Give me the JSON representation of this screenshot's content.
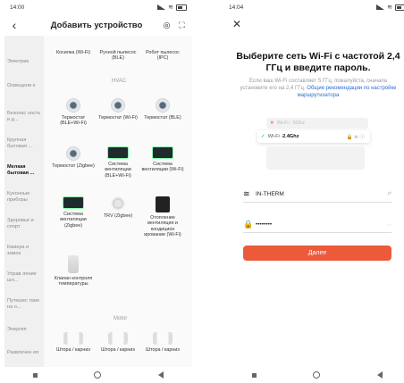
{
  "left": {
    "status_time": "14:00",
    "title": "Добавить устройство",
    "categories": [
      {
        "label": "Электрик",
        "active": false
      },
      {
        "label": "Освещени е",
        "active": false
      },
      {
        "label": "Безопас ность и д...",
        "active": false
      },
      {
        "label": "Крупная бытовая ...",
        "active": false
      },
      {
        "label": "Мелкая бытовая ...",
        "active": true
      },
      {
        "label": "Кухонные приборы",
        "active": false
      },
      {
        "label": "Здоровье и спорт",
        "active": false
      },
      {
        "label": "Камера и замок",
        "active": false
      },
      {
        "label": "Управ ление шл...",
        "active": false
      },
      {
        "label": "Путешес твие на о...",
        "active": false
      },
      {
        "label": "Энергия",
        "active": false
      },
      {
        "label": "Развлечен ия",
        "active": false
      }
    ],
    "section_hvac": "HVAC",
    "section_motor": "Motor",
    "devices": [
      {
        "label": "Косилка (Wi-Fi)"
      },
      {
        "label": "Ручной пылесос (BLE)"
      },
      {
        "label": "Робот пылесос (IPC)"
      },
      {
        "label": "Термостат (BLE+Wi-Fi)"
      },
      {
        "label": "Термостат (Wi-Fi)"
      },
      {
        "label": "Термостат (BLE)"
      },
      {
        "label": "Термостат (Zigbee)"
      },
      {
        "label": "Система вентиляции (BLE+Wi-Fi)"
      },
      {
        "label": "Система вентиляции (Wi-Fi)"
      },
      {
        "label": "Система вентиляции (Zigbee)"
      },
      {
        "label": "TRV (Zigbee)"
      },
      {
        "label": "Отопление вентиляция и кондицион ирование (Wi-Fi)"
      },
      {
        "label": "Клапан контроля температуры"
      },
      {
        "label": "Штора / карниз"
      },
      {
        "label": "Штора / карниз"
      },
      {
        "label": "Штора / карниз"
      }
    ]
  },
  "right": {
    "status_time": "14:04",
    "title": "Выберите сеть Wi-Fi с частотой 2,4 ГГц и введите пароль.",
    "description": "Если ваш Wi-Fi составляет 5 ГГц, пожалуйста, сначала установите его на 2,4 ГГц.",
    "description_link": "Общие рекомендации по настройке маршрутизатора",
    "illus_bad": "Wi-Fi - 5Ghz",
    "illus_good_prefix": "Wi-Fi - ",
    "illus_good_bold": "2.4Ghz",
    "ssid": "IN-THERM",
    "password": "••••••••",
    "next_button": "Далее"
  }
}
